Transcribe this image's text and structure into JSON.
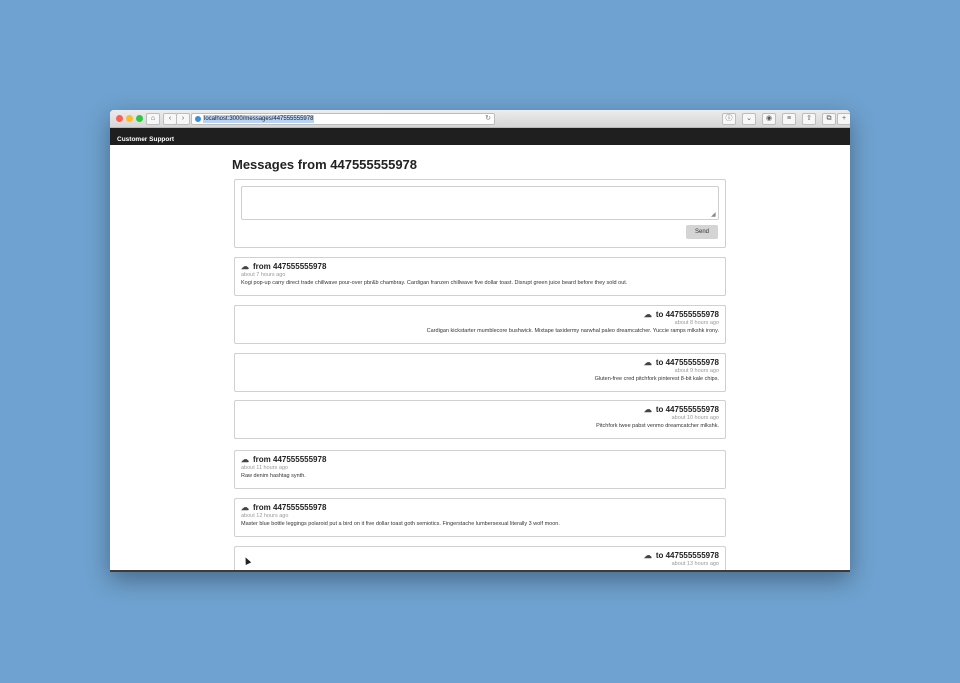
{
  "browser": {
    "url": "localhost:3000/messages/447555555978"
  },
  "navbar": {
    "brand": "Customer Support"
  },
  "page": {
    "title": "Messages from 447555555978"
  },
  "compose": {
    "send_label": "Send",
    "text_value": ""
  },
  "messages": [
    {
      "direction": "from",
      "header": "from 447555555978",
      "time": "about 7 hours ago",
      "body": "Kogi pop-up carry direct trade chillwave pour-over pbr&b chambray. Cardigan franzen chillwave five dollar toast. Disrupt green juice beard before they sold out."
    },
    {
      "direction": "to",
      "header": "to 447555555978",
      "time": "about 8 hours ago",
      "body": "Cardigan kickstarter mumblecore bushwick. Mixtape taxidermy narwhal paleo dreamcatcher. Yuccie ramps mlkshk irony."
    },
    {
      "direction": "to",
      "header": "to 447555555978",
      "time": "about 9 hours ago",
      "body": "Gluten-free cred pitchfork pinterest 8-bit kale chips."
    },
    {
      "direction": "to",
      "header": "to 447555555978",
      "time": "about 10 hours ago",
      "body": "Pitchfork twee pabst venmo dreamcatcher mlkshk."
    },
    {
      "direction": "from",
      "header": "from 447555555978",
      "time": "about 11 hours ago",
      "body": "Raw denim hashtag synth."
    },
    {
      "direction": "from",
      "header": "from 447555555978",
      "time": "about 12 hours ago",
      "body": "Master blue bottle leggings polaroid put a bird on it five dollar toast goth semiotics. Fingerstache lumbersexual literally 3 wolf moon."
    },
    {
      "direction": "to",
      "header": "to 447555555978",
      "time": "about 13 hours ago",
      "body": ""
    }
  ],
  "icons": {
    "message": "cloud-download-icon",
    "home": "home-icon",
    "back": "back-arrow-icon",
    "forward": "forward-arrow-icon",
    "reload": "reload-icon"
  },
  "colors": {
    "desktop": "#6fa2d0",
    "navbar": "#1f1f1f",
    "send_button": "#d4d4d4"
  }
}
